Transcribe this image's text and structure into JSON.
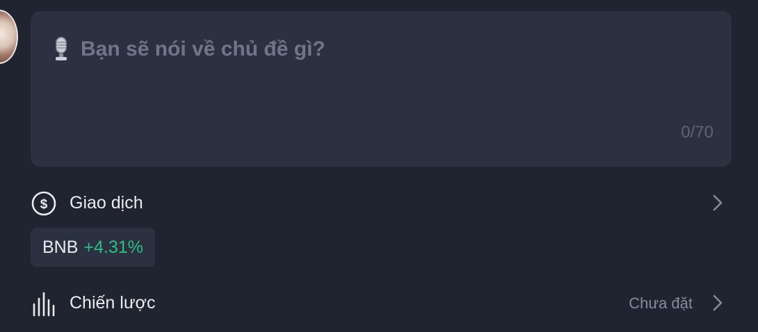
{
  "topic": {
    "placeholder": "Bạn sẽ nói về chủ đề gì?",
    "char_count": "0/70",
    "icon": "microphone-icon"
  },
  "trade": {
    "label": "Giao dịch",
    "icon": "dollar-circle-icon",
    "coin": {
      "symbol": "BNB",
      "change": "+4.31%"
    }
  },
  "strategy": {
    "label": "Chiến lược",
    "value": "Chưa đặt",
    "icon": "bar-chart-icon"
  },
  "colors": {
    "background": "#1f2430",
    "panel": "#2b3140",
    "positive": "#2ebd85",
    "muted_text": "#848b9a"
  }
}
